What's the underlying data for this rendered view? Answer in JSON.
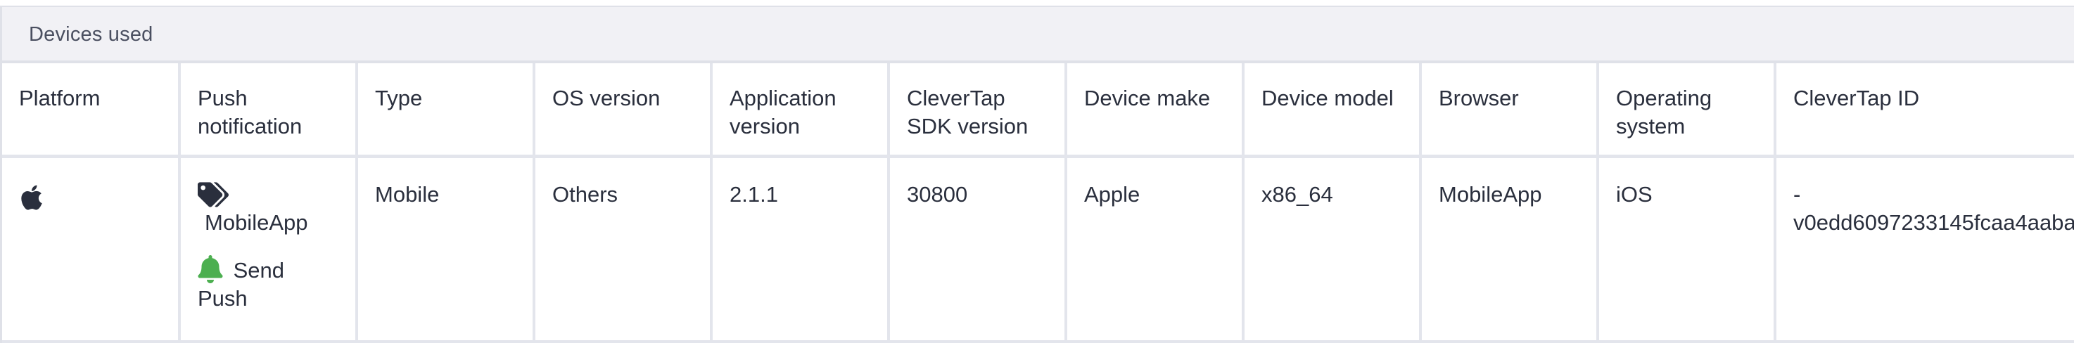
{
  "panel": {
    "title": "Devices used"
  },
  "table": {
    "headers": [
      "Platform",
      "Push notification",
      "Type",
      "OS version",
      "Application version",
      "CleverTap SDK version",
      "Device make",
      "Device model",
      "Browser",
      "Operating system",
      "CleverTap ID"
    ],
    "row": {
      "platform_icon": "apple-icon",
      "push": {
        "tag_icon": "tags-icon",
        "app": "MobileApp",
        "bell_icon": "bell-icon",
        "action": "Send Push"
      },
      "type": "Mobile",
      "os_version": "Others",
      "application_version": "2.1.1",
      "sdk_version": "30800",
      "device_make": "Apple",
      "device_model": "x86_64",
      "browser": "MobileApp",
      "operating_system": "iOS",
      "clevertap_id_prefix": "-",
      "clevertap_id": "v0edd6097233145fcaa4aaba"
    }
  },
  "colors": {
    "header_bg": "#f1f1f5",
    "border": "#e3e5ec",
    "bell_green": "#4caf50",
    "icon_dark": "#2a2f3d"
  }
}
